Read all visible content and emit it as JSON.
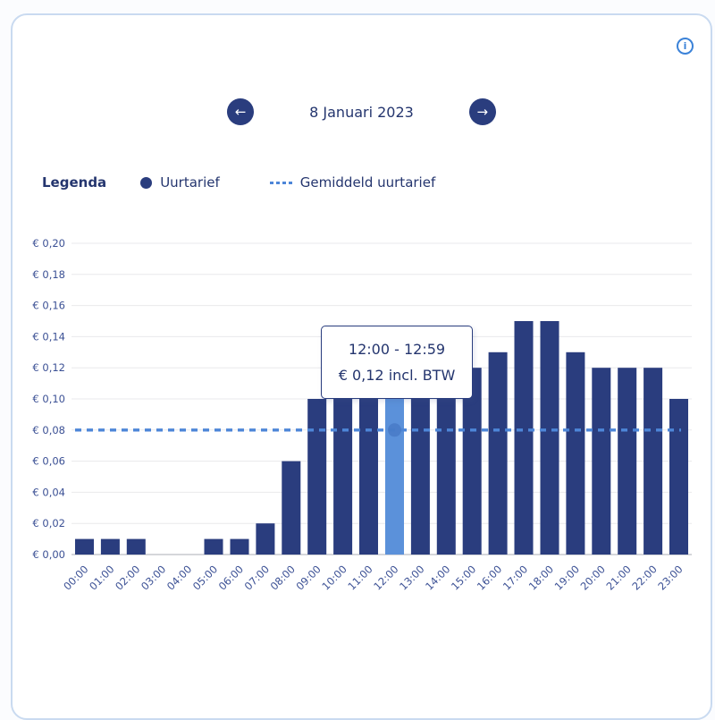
{
  "colors": {
    "bar": "#2a3d7e",
    "bar_highlight": "#5b91da",
    "average_line": "#4d86d8",
    "marker": "#4678c4",
    "grid": "#e9e9ec",
    "axis_line": "#c7c9ce",
    "axis_text": "#3c5195",
    "text": "#24356e",
    "accent": "#3b82d8",
    "card_border": "#c9daf0",
    "background": "#fbfcfe"
  },
  "header": {
    "info_icon_glyph": "i"
  },
  "date_nav": {
    "prev_icon": "←",
    "date_label": "8 Januari 2023",
    "next_icon": "→"
  },
  "legend": {
    "title": "Legenda",
    "items": [
      {
        "label": "Uurtarief",
        "marker": "dot"
      },
      {
        "label": "Gemiddeld uurtarief",
        "marker": "dashed-line"
      }
    ]
  },
  "tooltip": {
    "line1": "12:00 - 12:59",
    "line2": "€ 0,12 incl. BTW"
  },
  "chart_data": {
    "type": "bar",
    "title": "",
    "xlabel": "",
    "ylabel": "",
    "categories": [
      "00:00",
      "01:00",
      "02:00",
      "03:00",
      "04:00",
      "05:00",
      "06:00",
      "07:00",
      "08:00",
      "09:00",
      "10:00",
      "11:00",
      "12:00",
      "13:00",
      "14:00",
      "15:00",
      "16:00",
      "17:00",
      "18:00",
      "19:00",
      "20:00",
      "21:00",
      "22:00",
      "23:00"
    ],
    "series_name": "Uurtarief",
    "values": [
      0.01,
      0.01,
      0.01,
      0,
      0,
      0.01,
      0.01,
      0.02,
      0.06,
      0.1,
      0.1,
      0.1,
      0.1,
      0.1,
      0.1,
      0.12,
      0.13,
      0.15,
      0.15,
      0.13,
      0.12,
      0.12,
      0.12,
      0.1
    ],
    "highlighted_index": 12,
    "average_name": "Gemiddeld uurtarief",
    "average_value": 0.08,
    "ylim": [
      0,
      0.2
    ],
    "ytick_step": 0.02,
    "ytick_labels": [
      "€ 0,00",
      "€ 0,02",
      "€ 0,04",
      "€ 0,06",
      "€ 0,08",
      "€ 0,10",
      "€ 0,12",
      "€ 0,14",
      "€ 0,16",
      "€ 0,18",
      "€ 0,20"
    ],
    "grid": true,
    "legend_position": "top-left"
  }
}
